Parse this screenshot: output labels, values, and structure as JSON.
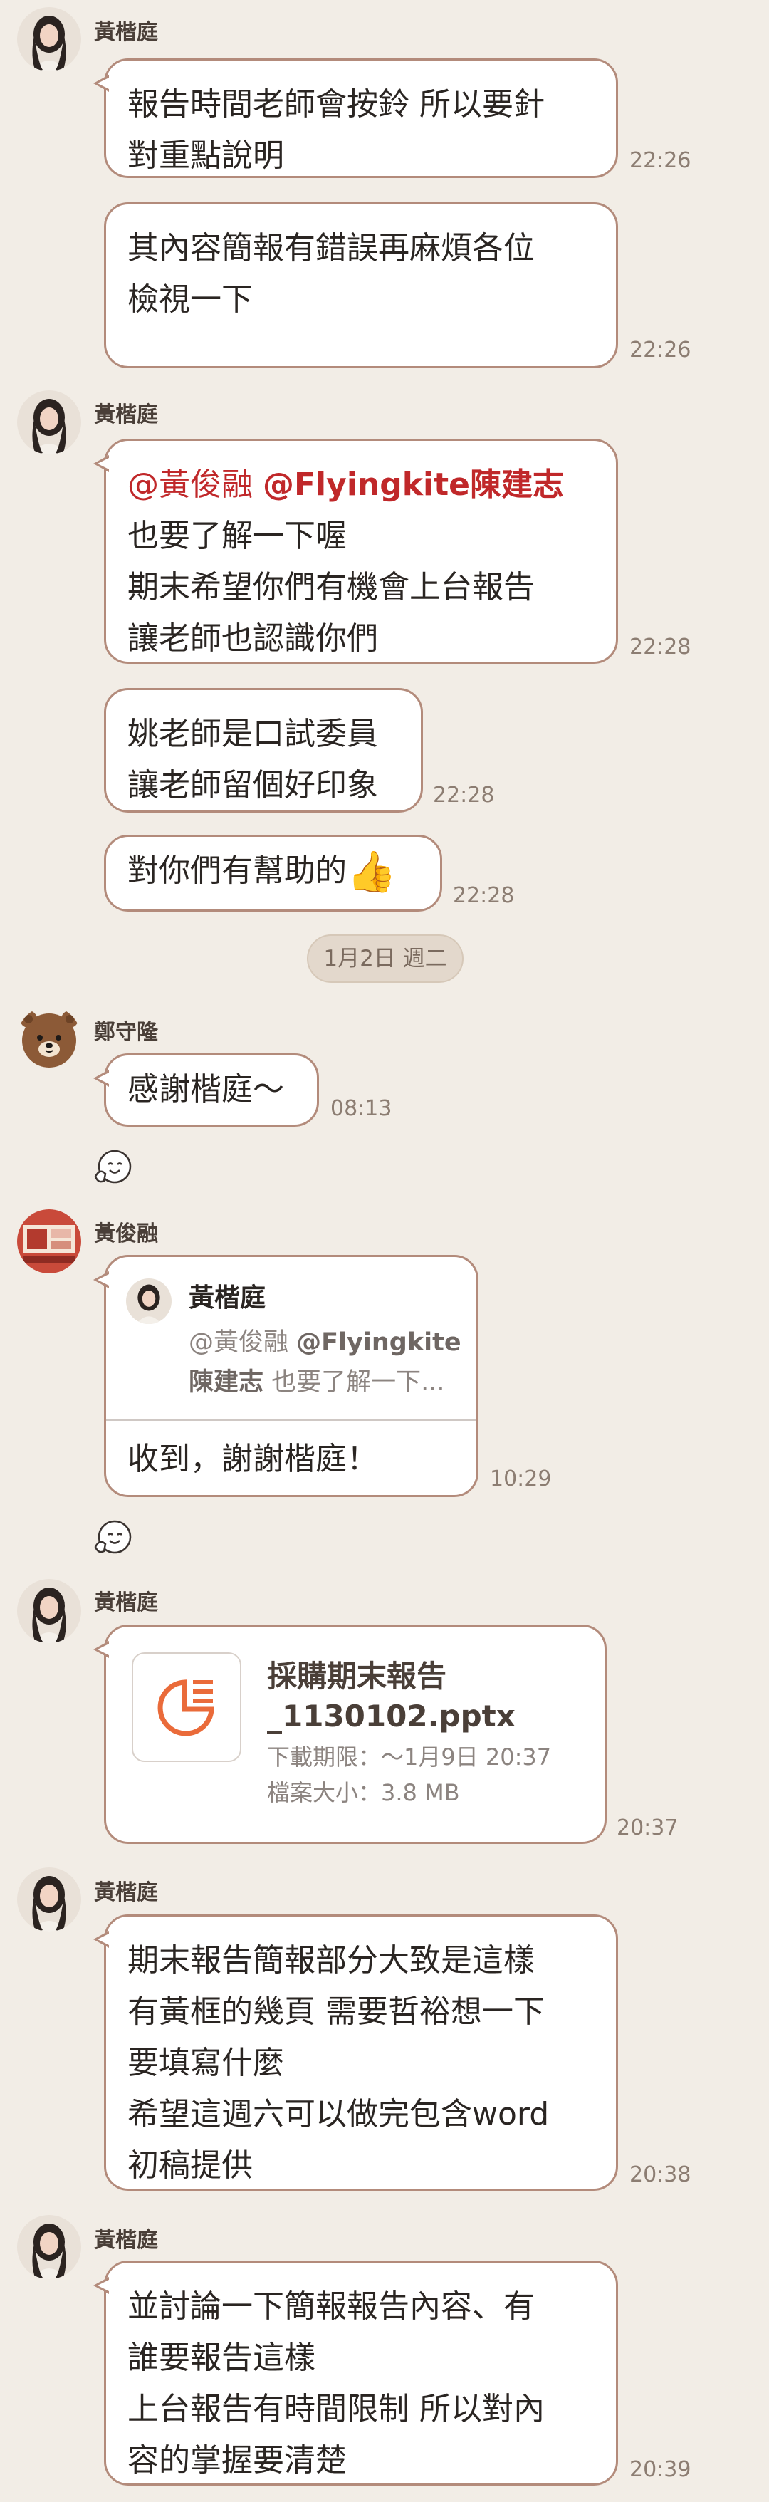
{
  "colors": {
    "background": "#f2ede6",
    "bubble_border": "#b38b7b",
    "mention": "#c0282a",
    "time": "#8c7d72",
    "file_icon": "#ea6b3a"
  },
  "msg1": {
    "sender": "黃楷庭",
    "line1": "報告時間老師會按鈴 所以要針",
    "line2": "對重點說明",
    "time": "22:26"
  },
  "msg2": {
    "line1": "其內容簡報有錯誤再麻煩各位",
    "line2": "檢視一下",
    "time": "22:26"
  },
  "msg3": {
    "sender": "黃楷庭",
    "mention1": "@黃俊融",
    "mention2": "@Flyingkite陳建志",
    "line2": "也要了解一下喔",
    "line3": "期末希望你們有機會上台報告",
    "line4": "讓老師也認識你們",
    "time": "22:28"
  },
  "msg4": {
    "line1": "姚老師是口試委員",
    "line2": "讓老師留個好印象",
    "time": "22:28"
  },
  "msg5": {
    "text": "對你們有幫助的",
    "emoji": "👍",
    "time": "22:28"
  },
  "date_separator": "1月2日 週二",
  "msg6": {
    "sender": "鄭守隆",
    "text": "感謝楷庭～",
    "time": "08:13",
    "reaction_icon": "smile-reaction-icon"
  },
  "msg7": {
    "sender": "黃俊融",
    "quote_name": "黃楷庭",
    "quote_line1_a": "@黃俊融 ",
    "quote_line1_b": "@Flyingkite",
    "quote_line2_a": "陳建志",
    "quote_line2_b": " 也要了解一下...",
    "text": "收到，謝謝楷庭！",
    "time": "10:29",
    "reaction_icon": "smile-reaction-icon"
  },
  "msg8": {
    "sender": "黃楷庭",
    "file_name_line1": "採購期末報告",
    "file_name_line2": "_1130102.pptx",
    "file_expiry": "下載期限：～1月9日 20:37",
    "file_size": "檔案大小：3.8 MB",
    "time": "20:37",
    "file_icon": "presentation-file-icon"
  },
  "msg9": {
    "sender": "黃楷庭",
    "line1": "期末報告簡報部分大致是這樣",
    "line2": "有黃框的幾頁 需要哲裕想一下",
    "line3": "要填寫什麼",
    "line4": "希望這週六可以做完包含word",
    "line5": "初稿提供",
    "time": "20:38"
  },
  "msg10": {
    "sender": "黃楷庭",
    "line1": "並討論一下簡報報告內容、有",
    "line2": "誰要報告這樣",
    "line3": "上台報告有時間限制 所以對內",
    "line4": "容的掌握要清楚",
    "time": "20:39"
  }
}
